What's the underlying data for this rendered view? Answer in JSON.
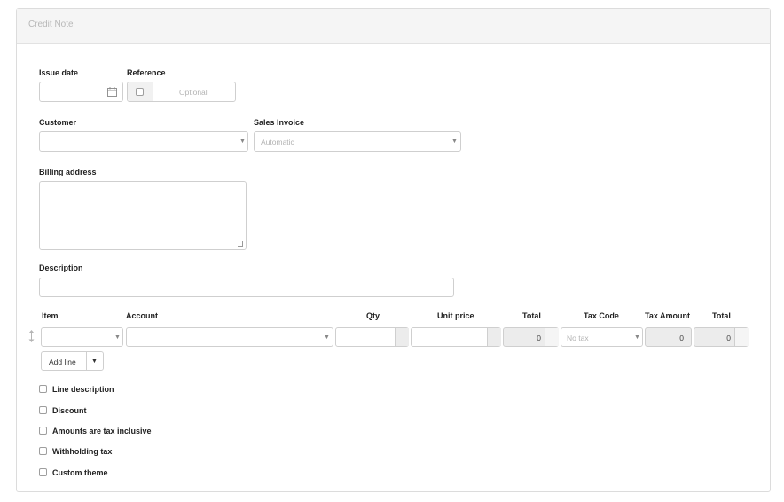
{
  "form": {
    "title": "Credit Note",
    "issue_date_label": "Issue date",
    "reference_label": "Reference",
    "reference_placeholder": "Optional",
    "customer_label": "Customer",
    "sales_invoice_label": "Sales Invoice",
    "sales_invoice_value": "Automatic",
    "billing_address_label": "Billing address",
    "description_label": "Description"
  },
  "lines": {
    "headers": {
      "item": "Item",
      "account": "Account",
      "qty": "Qty",
      "unit_price": "Unit price",
      "total": "Total",
      "tax_code": "Tax Code",
      "tax_amount": "Tax Amount",
      "total2": "Total"
    },
    "row": {
      "total_value": "0",
      "tax_code_value": "No tax",
      "tax_amount_value": "0",
      "total2_value": "0"
    },
    "add_line_label": "Add line"
  },
  "options": [
    "Line description",
    "Discount",
    "Amounts are tax inclusive",
    "Withholding tax",
    "Custom theme"
  ],
  "icons": {
    "calendar": "calendar-icon",
    "drag": "drag-handle-icon",
    "dropdown": "chevron-down-icon"
  }
}
